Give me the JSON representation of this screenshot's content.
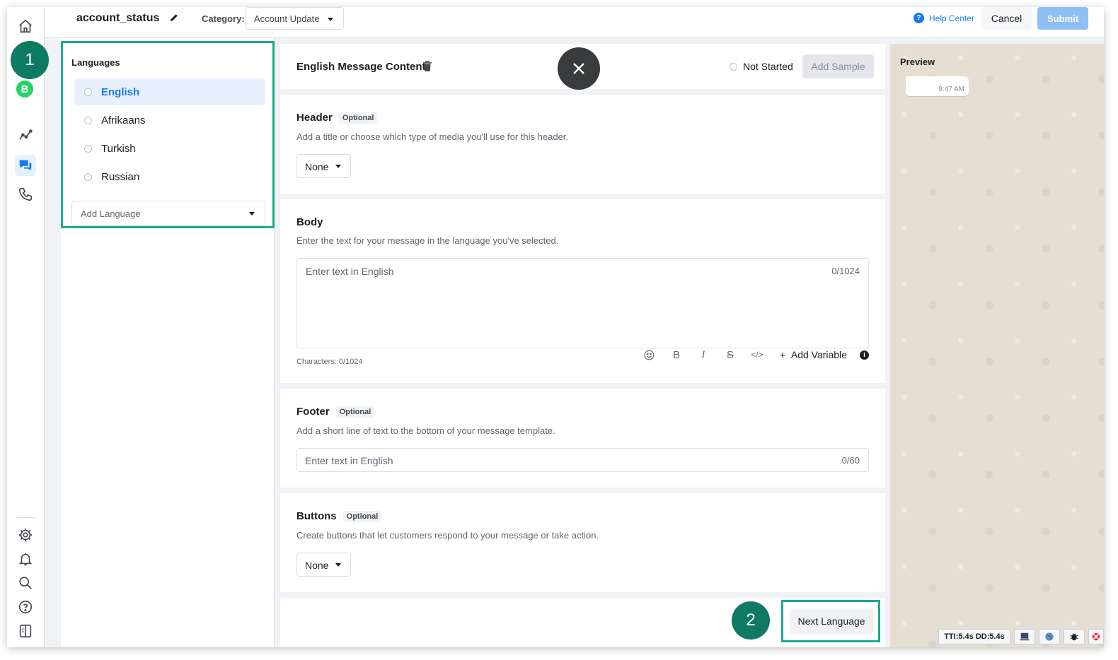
{
  "topbar": {
    "template_name": "account_status",
    "category_label": "Category:",
    "category_value": "Account Update",
    "help_label": "Help Center",
    "cancel_label": "Cancel",
    "submit_label": "Submit"
  },
  "languages": {
    "title": "Languages",
    "items": [
      {
        "label": "English"
      },
      {
        "label": "Afrikaans"
      },
      {
        "label": "Turkish"
      },
      {
        "label": "Russian"
      }
    ],
    "add_placeholder": "Add Language"
  },
  "content": {
    "title": "English Message Content",
    "status": "Not Started",
    "add_sample_label": "Add Sample",
    "optional_label": "Optional",
    "header": {
      "title": "Header",
      "desc": "Add a title or choose which type of media you'll use for this header.",
      "dropdown": "None"
    },
    "body": {
      "title": "Body",
      "desc": "Enter the text for your message in the language you've selected.",
      "placeholder": "Enter text in English",
      "counter": "0/1024",
      "characters": "Characters: 0/1024",
      "toolbar": {
        "bold": "B",
        "italic": "I",
        "strike": "S",
        "code": "</>",
        "add_variable": "Add Variable"
      }
    },
    "footer": {
      "title": "Footer",
      "desc": "Add a short line of text to the bottom of your message template.",
      "placeholder": "Enter text in English",
      "counter": "0/60"
    },
    "buttons": {
      "title": "Buttons",
      "desc": "Create buttons that let customers respond to your message or take action.",
      "dropdown": "None"
    },
    "next_label": "Next Language"
  },
  "preview": {
    "title": "Preview",
    "time": "9:47 AM"
  },
  "markers": {
    "one": "1",
    "two": "2"
  },
  "debug": {
    "timing": "TTI:5.4s DD:5.4s"
  },
  "colors": {
    "accent": "#1877f2",
    "highlight": "#1aaa8e",
    "marker": "#0e7a63"
  }
}
